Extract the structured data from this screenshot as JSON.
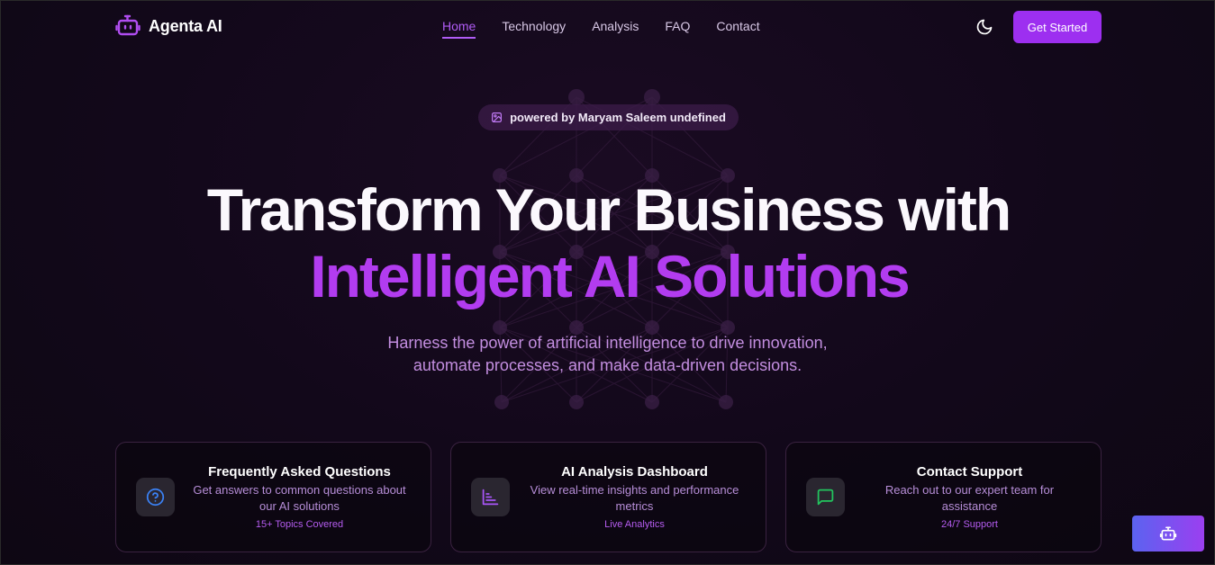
{
  "brand": {
    "name": "Agenta AI",
    "icon": "robot-icon",
    "accent": "#9d2ff0"
  },
  "nav": {
    "items": [
      {
        "label": "Home",
        "active": true
      },
      {
        "label": "Technology",
        "active": false
      },
      {
        "label": "Analysis",
        "active": false
      },
      {
        "label": "FAQ",
        "active": false
      },
      {
        "label": "Contact",
        "active": false
      }
    ]
  },
  "header": {
    "theme_icon": "moon-icon",
    "cta_label": "Get Started"
  },
  "hero": {
    "badge": {
      "icon": "image-icon",
      "text": "powered by Maryam Saleem undefined"
    },
    "title_line1": "Transform Your Business with",
    "title_line2": "Intelligent AI Solutions",
    "title_accent": "#b23cf0",
    "subtitle_line1": "Harness the power of artificial intelligence to drive innovation,",
    "subtitle_line2": "automate processes, and make data-driven decisions."
  },
  "cards": [
    {
      "icon": "help-circle-icon",
      "icon_color": "#3b82f6",
      "title": "Frequently Asked Questions",
      "desc_line1": "Get answers to common questions about",
      "desc_line2": "our AI solutions",
      "meta": "15+ Topics Covered"
    },
    {
      "icon": "bar-chart-icon",
      "icon_color": "#a855f7",
      "title": "AI Analysis Dashboard",
      "desc_line1": "View real-time insights and performance",
      "desc_line2": "metrics",
      "meta": "Live Analytics"
    },
    {
      "icon": "message-square-icon",
      "icon_color": "#22c55e",
      "title": "Contact Support",
      "desc_line1": "Reach out to our expert team for",
      "desc_line2": "assistance",
      "meta": "24/7 Support"
    }
  ],
  "chat_fab": {
    "icon": "bot-icon"
  }
}
